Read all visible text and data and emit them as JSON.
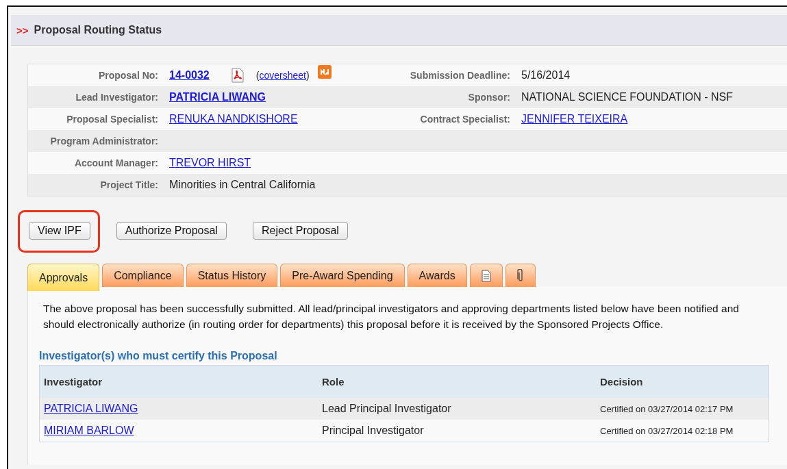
{
  "header": {
    "marker": ">>",
    "title": "Proposal Routing Status"
  },
  "info_rows": [
    {
      "label": "Proposal No:",
      "value": {
        "kind": "strong-link",
        "text": "14-0032"
      },
      "coversheet": {
        "open": "(",
        "link": "coversheet",
        "close": ")"
      },
      "right": {
        "label": "Submission Deadline:",
        "value": {
          "kind": "text",
          "text": "5/16/2014"
        }
      }
    },
    {
      "label": "Lead Investigator:",
      "value": {
        "kind": "strong-link",
        "text": "PATRICIA LIWANG"
      },
      "right": {
        "label": "Sponsor:",
        "value": {
          "kind": "text",
          "text": "NATIONAL SCIENCE FOUNDATION - NSF"
        }
      }
    },
    {
      "label": "Proposal Specialist:",
      "value": {
        "kind": "link",
        "text": "RENUKA NANDKISHORE"
      },
      "right": {
        "label": "Contract Specialist:",
        "value": {
          "kind": "link",
          "text": "JENNIFER TEIXEIRA"
        }
      }
    },
    {
      "label": "Program Administrator:"
    },
    {
      "label": "Account Manager:",
      "value": {
        "kind": "link",
        "text": "TREVOR HIRST"
      }
    },
    {
      "label": "Project Title:",
      "value": {
        "kind": "text",
        "text": "Minorities in Central California"
      }
    }
  ],
  "buttons": [
    {
      "label": "View IPF",
      "highlighted": true
    },
    {
      "label": "Authorize Proposal",
      "highlighted": false
    },
    {
      "label": "Reject Proposal",
      "highlighted": false
    }
  ],
  "tabs": [
    {
      "kind": "text",
      "label": "Approvals",
      "selected": true
    },
    {
      "kind": "text",
      "label": "Compliance",
      "selected": false
    },
    {
      "kind": "text",
      "label": "Status History",
      "selected": false
    },
    {
      "kind": "text",
      "label": "Pre-Award Spending",
      "selected": false
    },
    {
      "kind": "text",
      "label": "Awards",
      "selected": false
    },
    {
      "kind": "document",
      "selected": false
    },
    {
      "kind": "paperclip",
      "selected": false
    }
  ],
  "message": "The above proposal has been successfully submitted. All lead/principal investigators and approving departments listed below have been notified and should electronically authorize (in routing order for departments) this proposal before it is received by the Sponsored Projects Office.",
  "investigators": {
    "title": "Investigator(s) who must certify this Proposal",
    "columns": [
      "Investigator",
      "Role",
      "Decision"
    ],
    "rows": [
      {
        "name": "PATRICIA LIWANG",
        "role": "Lead Principal Investigator",
        "decision": "Certified on 03/27/2014 02:17 PM"
      },
      {
        "name": "MIRIAM BARLOW",
        "role": "Principal Investigator",
        "decision": "Certified on 03/27/2014 02:18 PM"
      }
    ]
  }
}
